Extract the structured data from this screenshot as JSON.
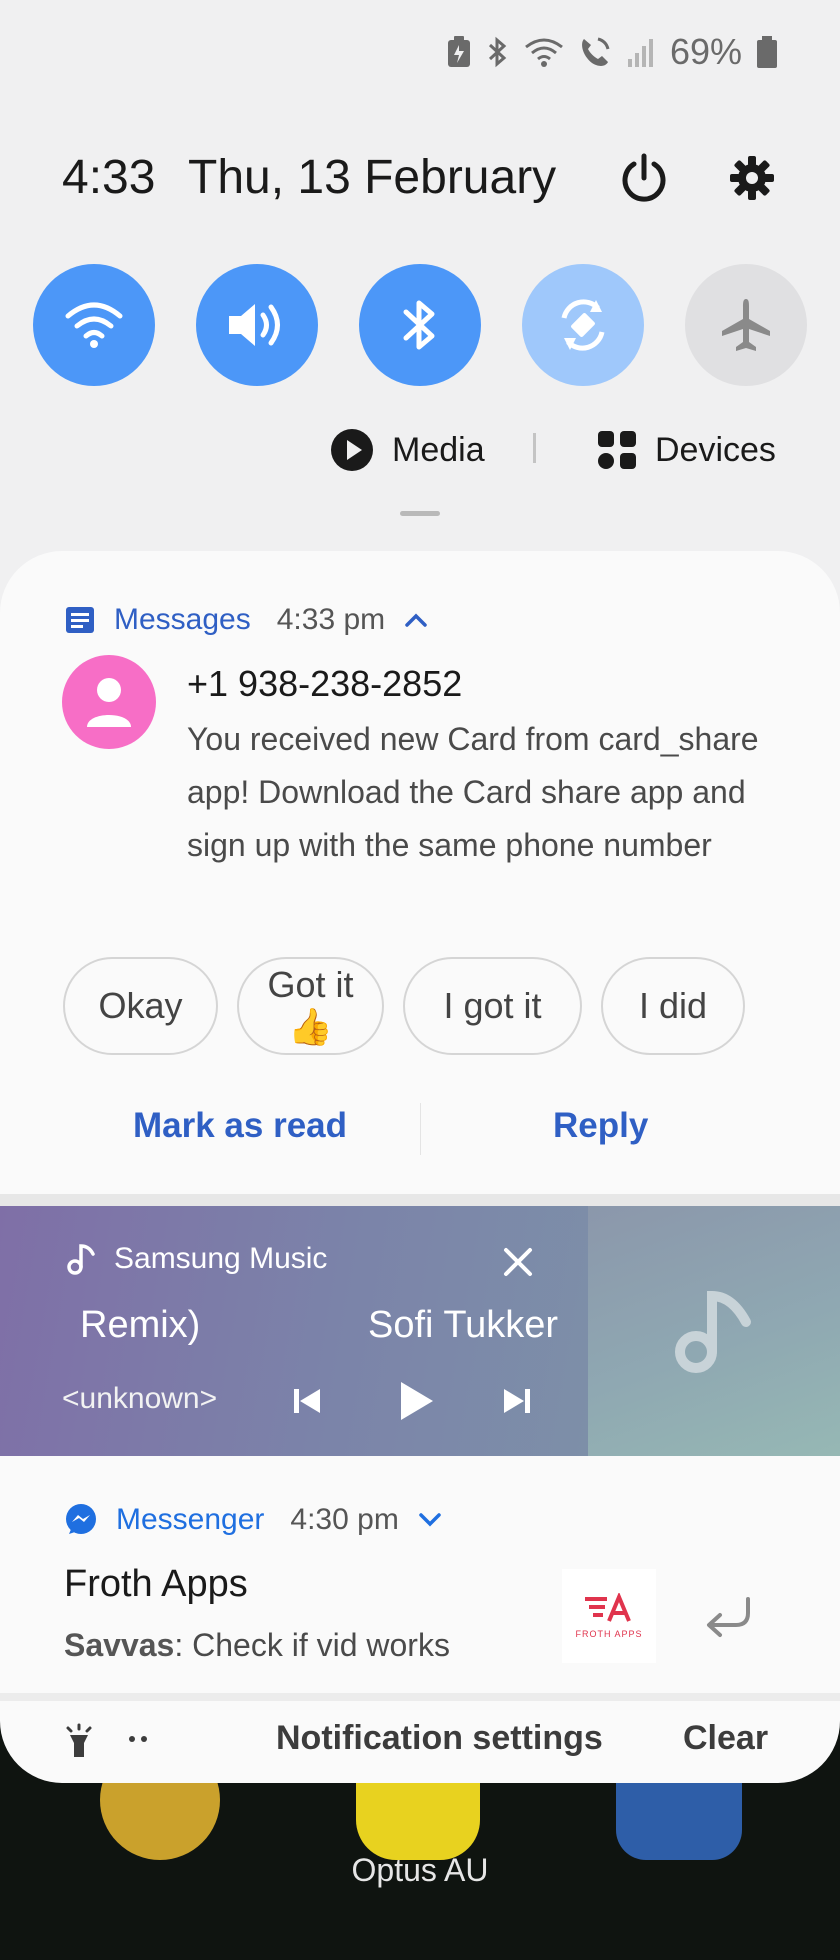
{
  "status_bar": {
    "battery_percent": "69%",
    "icons": [
      "battery-saver-icon",
      "bluetooth-icon",
      "wifi-calling-icon",
      "volte-call-icon",
      "signal-icon",
      "battery-icon"
    ]
  },
  "header": {
    "time": "4:33",
    "date": "Thu, 13 February"
  },
  "quick_settings": {
    "toggles": [
      {
        "name": "wifi",
        "state": "on"
      },
      {
        "name": "sound",
        "state": "on"
      },
      {
        "name": "bluetooth",
        "state": "on"
      },
      {
        "name": "auto-rotate",
        "state": "dim"
      },
      {
        "name": "airplane",
        "state": "off"
      }
    ],
    "media_label": "Media",
    "devices_label": "Devices"
  },
  "messages_notification": {
    "app": "Messages",
    "time": "4:33 pm",
    "sender": "+1 938-238-2852",
    "body": "You received new Card from card_share app!  Download the Card share app and sign up with the same phone number",
    "smart_replies": [
      "Okay",
      "Got it 👍",
      "I got it",
      "I did"
    ],
    "actions": {
      "mark_read": "Mark as read",
      "reply": "Reply"
    }
  },
  "music_player": {
    "app": "Samsung Music",
    "title": "Remix)",
    "artist": "Sofi Tukker",
    "album": "<unknown>"
  },
  "messenger_notification": {
    "app": "Messenger",
    "time": "4:30 pm",
    "title": "Froth Apps",
    "sender": "Savvas",
    "message": ": Check if vid works",
    "thumb_brand": "FROTH APPS"
  },
  "bottom_bar": {
    "settings": "Notification settings",
    "clear": "Clear"
  },
  "carrier": "Optus AU",
  "colors": {
    "accent_blue": "#4c97f8",
    "link_blue": "#2f5fc4",
    "avatar_pink": "#f76ec6",
    "messenger_blue": "#1f6fe0"
  }
}
